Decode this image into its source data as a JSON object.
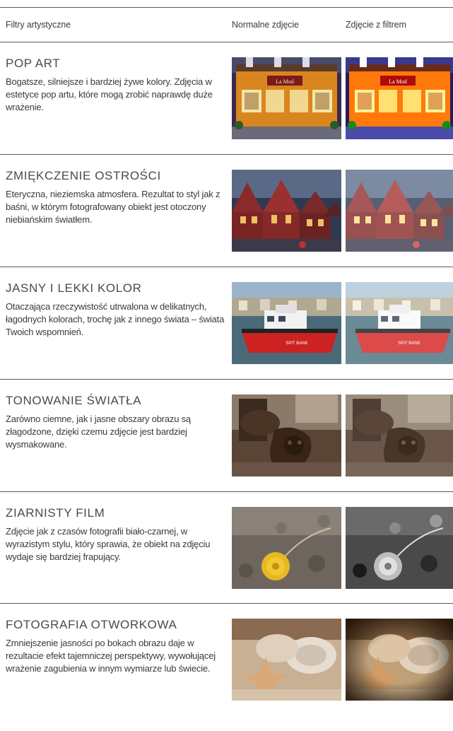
{
  "header": {
    "col1": "Filtry artystyczne",
    "col2": "Normalne zdjęcie",
    "col3": "Zdjęcie z filtrem"
  },
  "sections": [
    {
      "title": "POP ART",
      "desc": "Bogatsze, silniejsze i bardziej żywe kolory. Zdjęcia w estetyce pop artu, które mogą zrobić naprawdę duże wrażenie.",
      "sign_text": "La Mod",
      "photo": "pub-facade"
    },
    {
      "title": "ZMIĘKCZENIE OSTROŚCI",
      "desc": "Eteryczna, nieziemska atmosfera. Rezultat to styl jak z baśni, w którym fotografowany obiekt jest otoczony niebiańskim światłem.",
      "photo": "wooden-houses-harbor"
    },
    {
      "title": "JASNY I LEKKI KOLOR",
      "desc": "Otaczająca rzeczywistość utrwalona w delikatnych, łagodnych kolorach, trochę jak z innego świata – świata Twoich wspomnień.",
      "boat_name": "SPIT BANK",
      "photo": "red-tugboat"
    },
    {
      "title": "TONOWANIE ŚWIATŁA",
      "desc": "Zarówno ciemne, jak i jasne obszary obrazu są złagodzone, dzięki czemu zdjęcie jest bardziej wysmakowane.",
      "photo": "carved-chair"
    },
    {
      "title": "ZIARNISTY FILM",
      "desc": "Zdjęcie jak z czasów fotografii biało-czarnej, w wyrazistym stylu, który sprawia, że obiekt na zdjęciu wydaje się bardziej frapujący.",
      "photo": "dandelion"
    },
    {
      "title": "FOTOGRAFIA OTWORKOWA",
      "desc": "Zmniejszenie jasności po bokach obrazu daje w rezultacie efekt tajemniczej perspektywy, wywołującej wrażenie zagubienia w innym wymiarze lub świecie.",
      "photo": "starfish-shells"
    }
  ]
}
